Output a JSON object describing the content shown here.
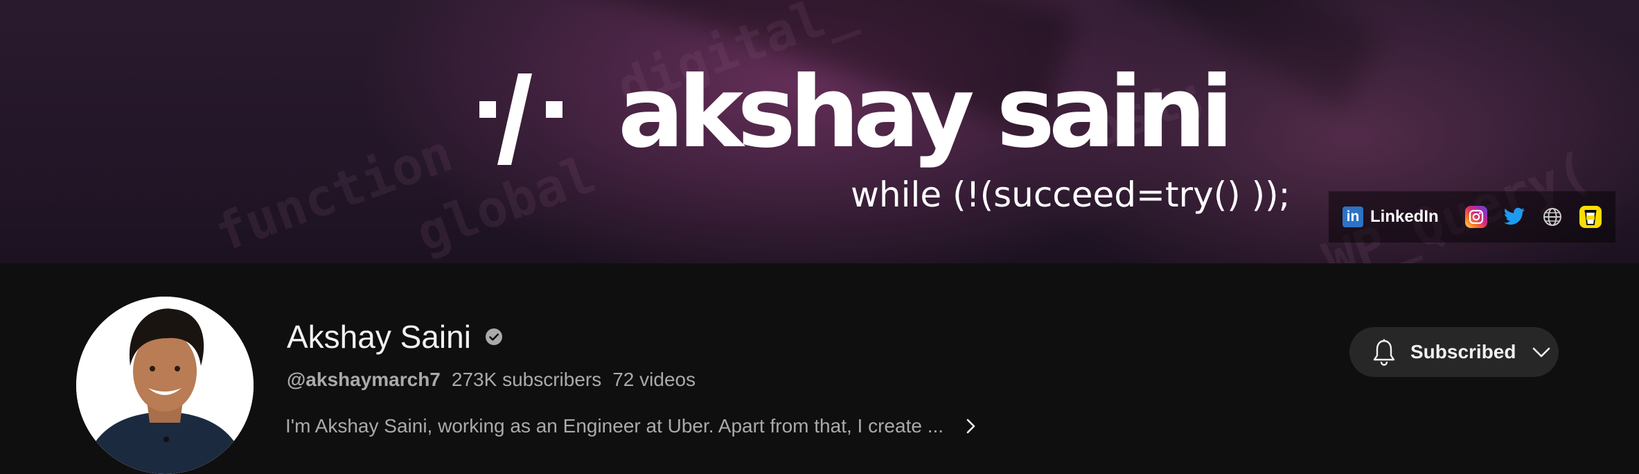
{
  "banner": {
    "title": "akshay saini",
    "tagline": "while (!(succeed=try() ));",
    "background_code": [
      "function",
      "global",
      "digital_",
      "ost;",
      "WP_Query("
    ],
    "links": {
      "linkedin_label": "LinkedIn",
      "icons": [
        "linkedin-icon",
        "instagram-icon",
        "twitter-icon",
        "globe-icon",
        "buymeacoffee-icon"
      ]
    }
  },
  "channel": {
    "name": "Akshay Saini",
    "verified": true,
    "handle": "@akshaymarch7",
    "subscribers": "273K subscribers",
    "videos": "72 videos",
    "description": "I'm Akshay Saini, working as an Engineer at Uber. Apart from that, I create ..."
  },
  "subscribe_button": {
    "label": "Subscribed",
    "icons": [
      "bell-icon",
      "chevron-down-icon"
    ]
  },
  "colors": {
    "page_background": "#0f0f0f",
    "button_background": "#272727",
    "primary_text": "#f1f1f1",
    "secondary_text": "#aaaaaa",
    "linkedin_blue": "#2d72c5"
  }
}
